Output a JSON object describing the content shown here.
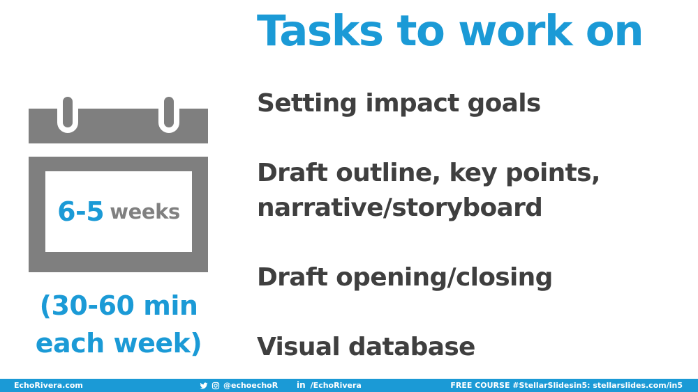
{
  "slide": {
    "title": "Tasks to work on",
    "tasks": [
      {
        "lines": [
          "Setting impact goals"
        ]
      },
      {
        "lines": [
          "Draft outline, key points,",
          "narrative/storyboard"
        ]
      },
      {
        "lines": [
          "Draft opening/closing"
        ]
      },
      {
        "lines": [
          "Visual database"
        ]
      }
    ],
    "calendar": {
      "icon": "calendar-icon",
      "number": "6-5",
      "unit": "weeks"
    },
    "duration": {
      "line1": "(30-60 min",
      "line2": "each week)"
    }
  },
  "footer": {
    "website": "EchoRivera.com",
    "social_handle": "@echoechoR",
    "social_icons": [
      "twitter-icon",
      "instagram-icon"
    ],
    "linkedin_icon": "linkedin-icon",
    "linkedin": "/EchoRivera",
    "promo": "FREE COURSE #StellarSlidesin5: stellarslides.com/in5"
  },
  "colors": {
    "accent": "#1b9ad6",
    "text_dark": "#3f3f3f",
    "calendar_gray": "#7f7f7f",
    "unit_gray": "#808080",
    "footer_bg": "#1b9ad6"
  }
}
